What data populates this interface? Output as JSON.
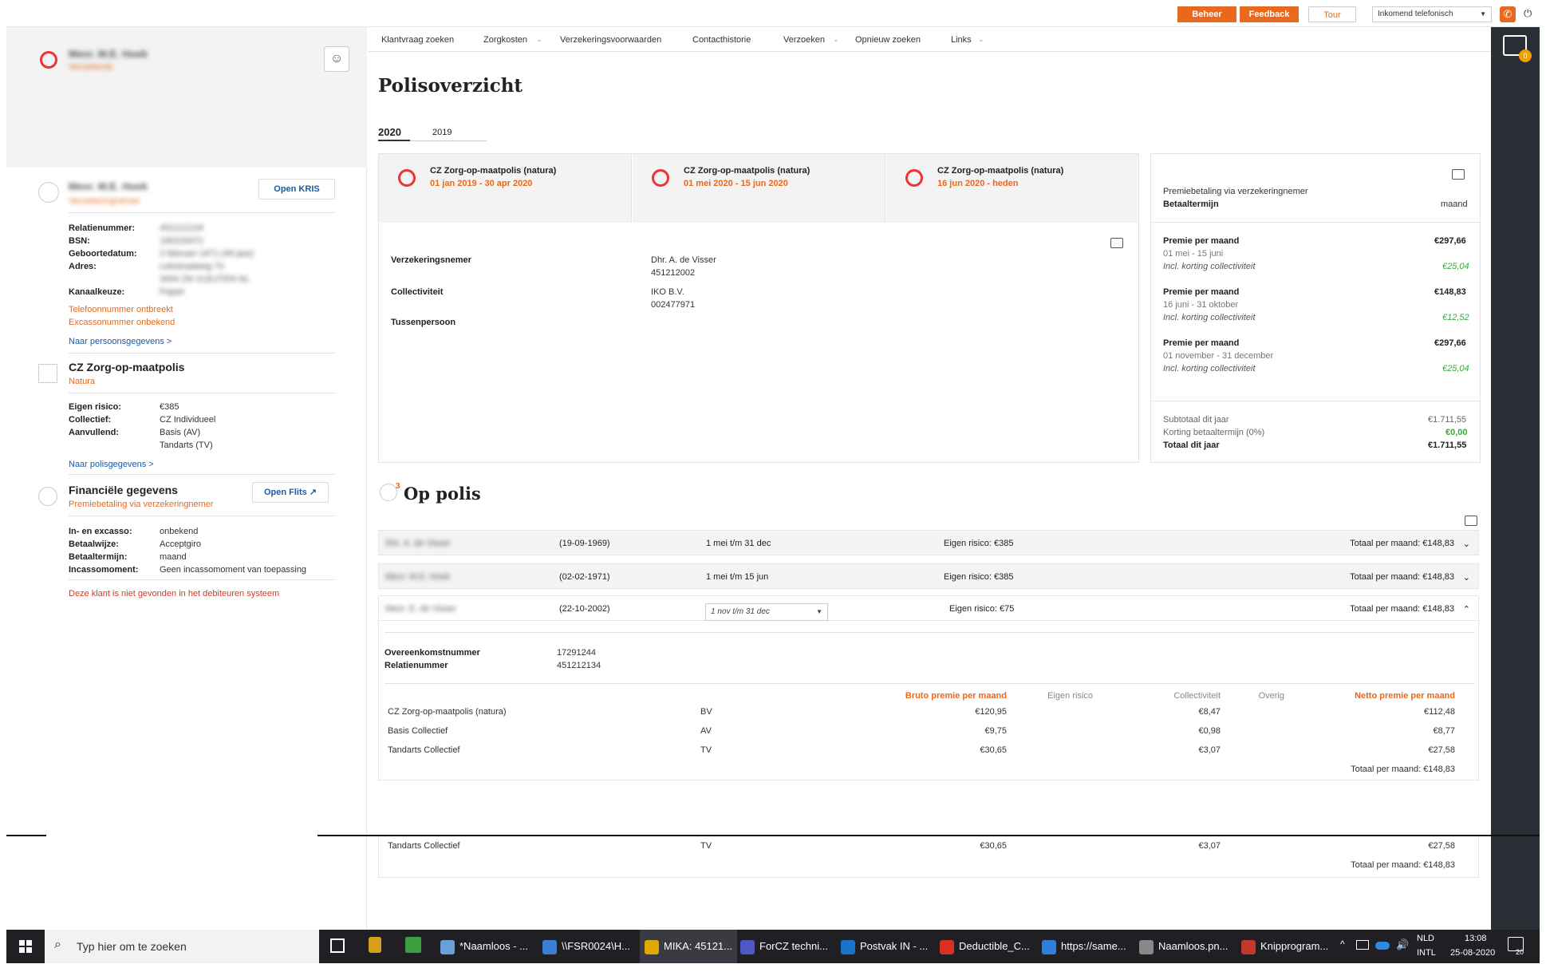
{
  "topbar": {
    "beheer": "Beheer",
    "feedback": "Feedback",
    "tour": "Tour",
    "channel_select": "Inkomend telefonisch",
    "chat_badge": "0"
  },
  "nav": [
    "Klantvraag zoeken",
    "Zorgkosten",
    "Verzekeringsvoorwaarden",
    "Contacthistorie",
    "Verzoeken",
    "Opnieuw zoeken",
    "Links"
  ],
  "sidebar": {
    "header_name": "Mevr. M.E. Hoek",
    "header_sub": "Verzekerde",
    "person": {
      "name": "Mevr. M.E. Hoek",
      "role": "Verzekeringnemer",
      "open_kris": "Open KRIS",
      "fields": [
        {
          "label": "Relatienummer:",
          "value": "451212134"
        },
        {
          "label": "BSN:",
          "value": "190229472"
        },
        {
          "label": "Geboortedatum:",
          "value": "2 februari 1971 (49 jaar)"
        },
        {
          "label": "Adres:",
          "value": "Lekstraatweg 70"
        },
        {
          "label": "",
          "value": "3454 ZN VLEUTEN NL"
        },
        {
          "label": "Kanaalkeuze:",
          "value": "Papier"
        }
      ],
      "warning1": "Telefoonnummer ontbreekt",
      "warning2": "Excassonummer onbekend",
      "link": "Naar persoonsgegevens >"
    },
    "policy": {
      "title": "CZ Zorg-op-maatpolis",
      "sub": "Natura",
      "fields": [
        {
          "label": "Eigen risico:",
          "value": "€385"
        },
        {
          "label": "Collectief:",
          "value": "CZ Individueel"
        },
        {
          "label": "Aanvullend:",
          "value": "Basis (AV)"
        },
        {
          "label": "",
          "value": "Tandarts (TV)"
        }
      ],
      "link": "Naar polisgegevens >"
    },
    "finance": {
      "title": "Financiële gegevens",
      "sub": "Premiebetaling via verzekeringnemer",
      "open_flits": "Open Flits",
      "fields": [
        {
          "label": "In- en excasso:",
          "value": "onbekend"
        },
        {
          "label": "Betaalwijze:",
          "value": "Acceptgiro"
        },
        {
          "label": "Betaaltermijn:",
          "value": "maand"
        },
        {
          "label": "Incassomoment:",
          "value": "Geen incassomoment van toepassing"
        }
      ],
      "warning": "Deze klant is niet gevonden in het debiteuren systeem"
    }
  },
  "main": {
    "title": "Polisoverzicht",
    "year_tabs": [
      "2020",
      "2019"
    ],
    "policies": [
      {
        "name": "CZ Zorg-op-maatpolis (natura)",
        "period": "01 jan 2019 - 30 apr 2020"
      },
      {
        "name": "CZ Zorg-op-maatpolis (natura)",
        "period": "01 mei 2020 - 15 jun 2020"
      },
      {
        "name": "CZ Zorg-op-maatpolis (natura)",
        "period": "16 jun 2020 - heden"
      }
    ],
    "details": {
      "verzekeringnemer_label": "Verzekeringsnemer",
      "verzekeringnemer_value1": "Dhr. A. de Visser",
      "verzekeringnemer_value2": "451212002",
      "collectiviteit_label": "Collectiviteit",
      "collectiviteit_value1": "IKO B.V.",
      "collectiviteit_value2": "002477971",
      "tussenpersoon_label": "Tussenpersoon"
    },
    "premium": {
      "betaling": "Premiebetaling via verzekeringnemer",
      "termijn_label": "Betaaltermijn",
      "termijn_value": "maand",
      "blocks": [
        {
          "label": "Premie per maand",
          "amount": "€297,66",
          "period": "01 mei - 15 juni",
          "korting_label": "Incl. korting collectiviteit",
          "korting": "€25,04"
        },
        {
          "label": "Premie per maand",
          "amount": "€148,83",
          "period": "16 juni - 31 oktober",
          "korting_label": "Incl. korting collectiviteit",
          "korting": "€12,52"
        },
        {
          "label": "Premie per maand",
          "amount": "€297,66",
          "period": "01 november - 31 december",
          "korting_label": "Incl. korting collectiviteit",
          "korting": "€25,04"
        }
      ],
      "subtotaal_label": "Subtotaal dit jaar",
      "subtotaal": "€1.711,55",
      "korting_label": "Korting betaaltermijn (0%)",
      "korting": "€0,00",
      "totaal_label": "Totaal dit jaar",
      "totaal": "€1.711,55"
    },
    "op_polis": {
      "title": "Op polis",
      "count": "3",
      "rows": [
        {
          "name": "Dhr. A. de Visser",
          "dob": "(19-09-1969)",
          "period": "1 mei t/m 31 dec",
          "er": "Eigen risico: €385",
          "total": "Totaal per maand: €148,83"
        },
        {
          "name": "Mevr. M.E. Hoek",
          "dob": "(02-02-1971)",
          "period": "1 mei t/m 15 jun",
          "er": "Eigen risico: €385",
          "total": "Totaal per maand: €148,83"
        },
        {
          "name": "Mevr. E. de Visser",
          "dob": "(22-10-2002)",
          "period": "1 nov t/m 31 dec",
          "er": "Eigen risico: €75",
          "total": "Totaal per maand: €148,83"
        }
      ],
      "expanded": {
        "overeenkomst_label": "Overeenkomstnummer",
        "overeenkomst": "17291244",
        "relatie_label": "Relatienummer",
        "relatie": "451212134",
        "headers": [
          "Bruto premie per maand",
          "Eigen risico",
          "Collectiviteit",
          "Overig",
          "Netto premie per maand"
        ],
        "lines": [
          {
            "name": "CZ Zorg-op-maatpolis (natura)",
            "code": "BV",
            "bruto": "€120,95",
            "coll": "€8,47",
            "netto": "€112,48"
          },
          {
            "name": "Basis Collectief",
            "code": "AV",
            "bruto": "€9,75",
            "coll": "€0,98",
            "netto": "€8,77"
          },
          {
            "name": "Tandarts Collectief",
            "code": "TV",
            "bruto": "€30,65",
            "coll": "€3,07",
            "netto": "€27,58"
          }
        ],
        "total": "Totaal per maand: €148,83"
      },
      "repeat": {
        "name": "Tandarts Collectief",
        "code": "TV",
        "bruto": "€30,65",
        "coll": "€3,07",
        "netto": "€27,58",
        "total": "Totaal per maand: €148,83"
      }
    }
  },
  "taskbar": {
    "search": "Typ hier om te zoeken",
    "items": [
      "*Naamloos - ...",
      "\\\\FSR0024\\H...",
      "MIKA: 45121...",
      "ForCZ techni...",
      "Postvak IN - ...",
      "Deductible_C...",
      "https://same...",
      "Naamloos.pn...",
      "Knipprogram..."
    ],
    "lang1": "NLD",
    "lang2": "INTL",
    "time": "13:08",
    "date": "25-08-2020",
    "notif": "20"
  }
}
